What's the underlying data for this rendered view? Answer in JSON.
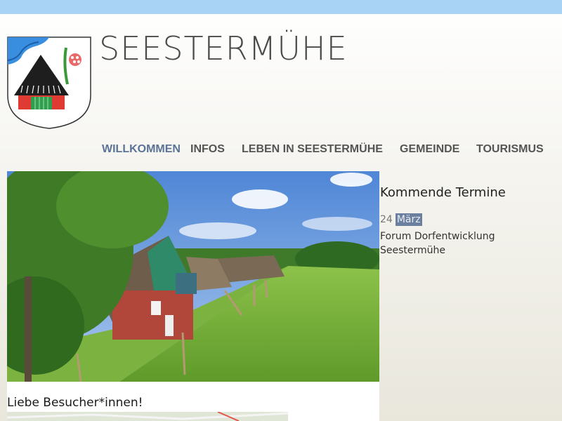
{
  "site": {
    "title": "SEESTERMÜHE"
  },
  "nav": {
    "items": [
      {
        "label": "WILLKOMMEN",
        "active": true
      },
      {
        "label": "INFOS",
        "active": false
      },
      {
        "label": "LEBEN IN SEESTERMÜHE",
        "active": false
      },
      {
        "label": "GEMEINDE",
        "active": false
      },
      {
        "label": "TOURISMUS",
        "active": false
      }
    ]
  },
  "main": {
    "welcome_heading": "Liebe Besucher*innen!"
  },
  "sidebar": {
    "title": "Kommende Termine",
    "events": [
      {
        "day": "24",
        "month": "März",
        "title": "Forum Dorfentwicklung Seestermühe"
      }
    ]
  },
  "colors": {
    "topbar": "#a9d3f4",
    "nav_active": "#5b7396",
    "nav_default": "#555555",
    "date_highlight": "#6b7f9f"
  }
}
